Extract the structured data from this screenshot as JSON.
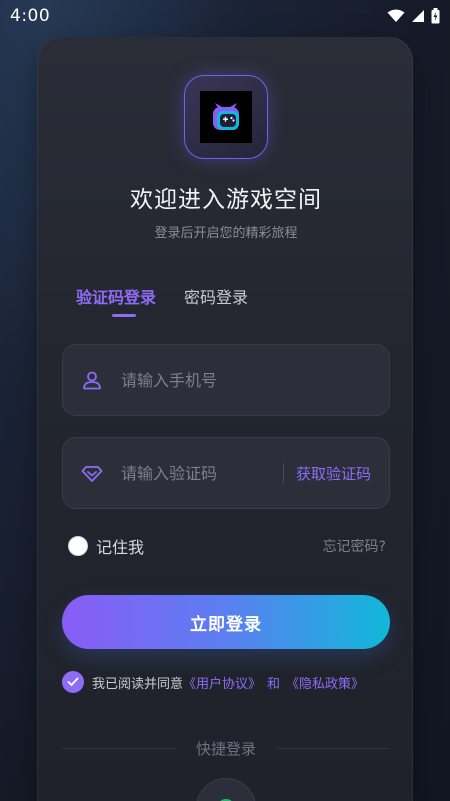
{
  "status_bar": {
    "time": "4:00"
  },
  "header": {
    "title": "欢迎进入游戏空间",
    "subtitle": "登录后开启您的精彩旅程"
  },
  "tabs": [
    {
      "label": "验证码登录",
      "active": true
    },
    {
      "label": "密码登录",
      "active": false
    }
  ],
  "form": {
    "phone_placeholder": "请输入手机号",
    "code_placeholder": "请输入验证码",
    "get_code_label": "获取验证码",
    "remember_label": "记住我",
    "forgot_label": "忘记密码?",
    "login_label": "立即登录"
  },
  "agreement": {
    "checked": true,
    "prefix": "我已阅读并同意",
    "user_agreement": "《用户协议》",
    "and": "和",
    "privacy_policy": "《隐私政策》"
  },
  "quick_login": {
    "label": "快捷登录"
  },
  "colors": {
    "accent": "#8e6cf5",
    "gradient_start": "#8a5cf6",
    "gradient_end": "#11b8d9",
    "quick_icon": "#13c26b"
  }
}
